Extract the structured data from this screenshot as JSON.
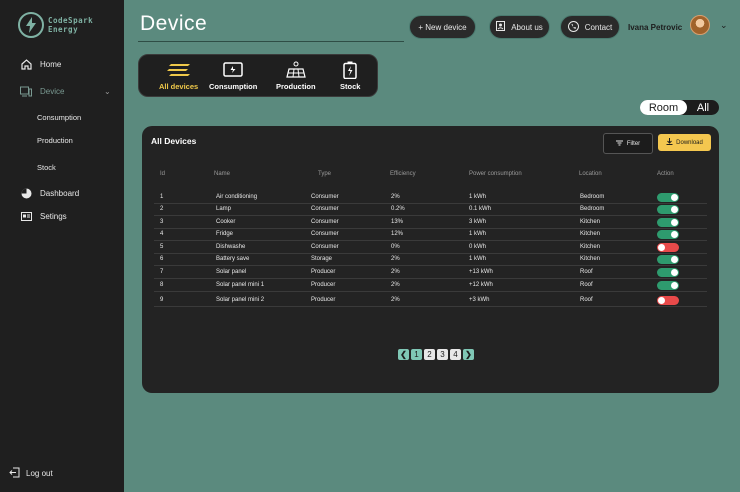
{
  "brand": {
    "line1": "CodeSpark",
    "line2": "Energy"
  },
  "sidebar": {
    "home": "Home",
    "device": "Device",
    "sub": [
      "Consumption",
      "Production",
      "Stock"
    ],
    "dashboard": "Dashboard",
    "settings": "Setings",
    "logout": "Log out"
  },
  "header": {
    "title": "Device",
    "new_device": "+ New device",
    "about": "About us",
    "contact": "Contact",
    "user_name": "Ivana Petrovic"
  },
  "categories": [
    {
      "label": "All devices",
      "icon": "bars-icon",
      "active": true
    },
    {
      "label": "Consumption",
      "icon": "plug-screen-icon",
      "active": false
    },
    {
      "label": "Production",
      "icon": "solar-panel-icon",
      "active": false
    },
    {
      "label": "Stock",
      "icon": "battery-icon",
      "active": false
    }
  ],
  "view_toggle": {
    "room": "Room",
    "all": "All"
  },
  "panel": {
    "title": "All Devices",
    "filter": "Filter",
    "download": "Download",
    "columns": [
      "Id",
      "Name",
      "Type",
      "Efficiency",
      "Power consumption",
      "Location",
      "Action"
    ],
    "rows": [
      {
        "id": "1",
        "name": "Air conditioning",
        "type": "Consumer",
        "efficiency": "2%",
        "power": "1 kWh",
        "location": "Bedroom",
        "on": true
      },
      {
        "id": "2",
        "name": "Lamp",
        "type": "Consumer",
        "efficiency": "0.2%",
        "power": "0.1 kWh",
        "location": "Bedroom",
        "on": true
      },
      {
        "id": "3",
        "name": "Cooker",
        "type": "Consumer",
        "efficiency": "13%",
        "power": "3 kWh",
        "location": "Kitchen",
        "on": true
      },
      {
        "id": "4",
        "name": "Fridge",
        "type": "Consumer",
        "efficiency": "12%",
        "power": "1 kWh",
        "location": "Kitchen",
        "on": true
      },
      {
        "id": "5",
        "name": "Dishwashe",
        "type": "Consumer",
        "efficiency": "0%",
        "power": "0 kWh",
        "location": "Kitchen",
        "on": false
      },
      {
        "id": "6",
        "name": "Battery save",
        "type": "Storage",
        "efficiency": "2%",
        "power": "1 kWh",
        "location": "Kitchen",
        "on": true
      },
      {
        "id": "7",
        "name": "Solar panel",
        "type": "Producer",
        "efficiency": "2%",
        "power": "+13 kWh",
        "location": "Roof",
        "on": true
      },
      {
        "id": "8",
        "name": "Solar panel mini 1",
        "type": "Producer",
        "efficiency": "2%",
        "power": "+12 kWh",
        "location": "Roof",
        "on": true
      },
      {
        "id": "9",
        "name": "Solar panel mini 2",
        "type": "Producer",
        "efficiency": "2%",
        "power": "+3 kWh",
        "location": "Roof",
        "on": false
      }
    ]
  },
  "pagination": {
    "prev": "❮",
    "pages": [
      "1",
      "2",
      "3",
      "4"
    ],
    "next": "❯",
    "current": "1"
  },
  "colors": {
    "accent": "#f4c74f",
    "teal": "#5b8a7e",
    "on": "#2e9b6e",
    "off": "#e84a4a"
  }
}
